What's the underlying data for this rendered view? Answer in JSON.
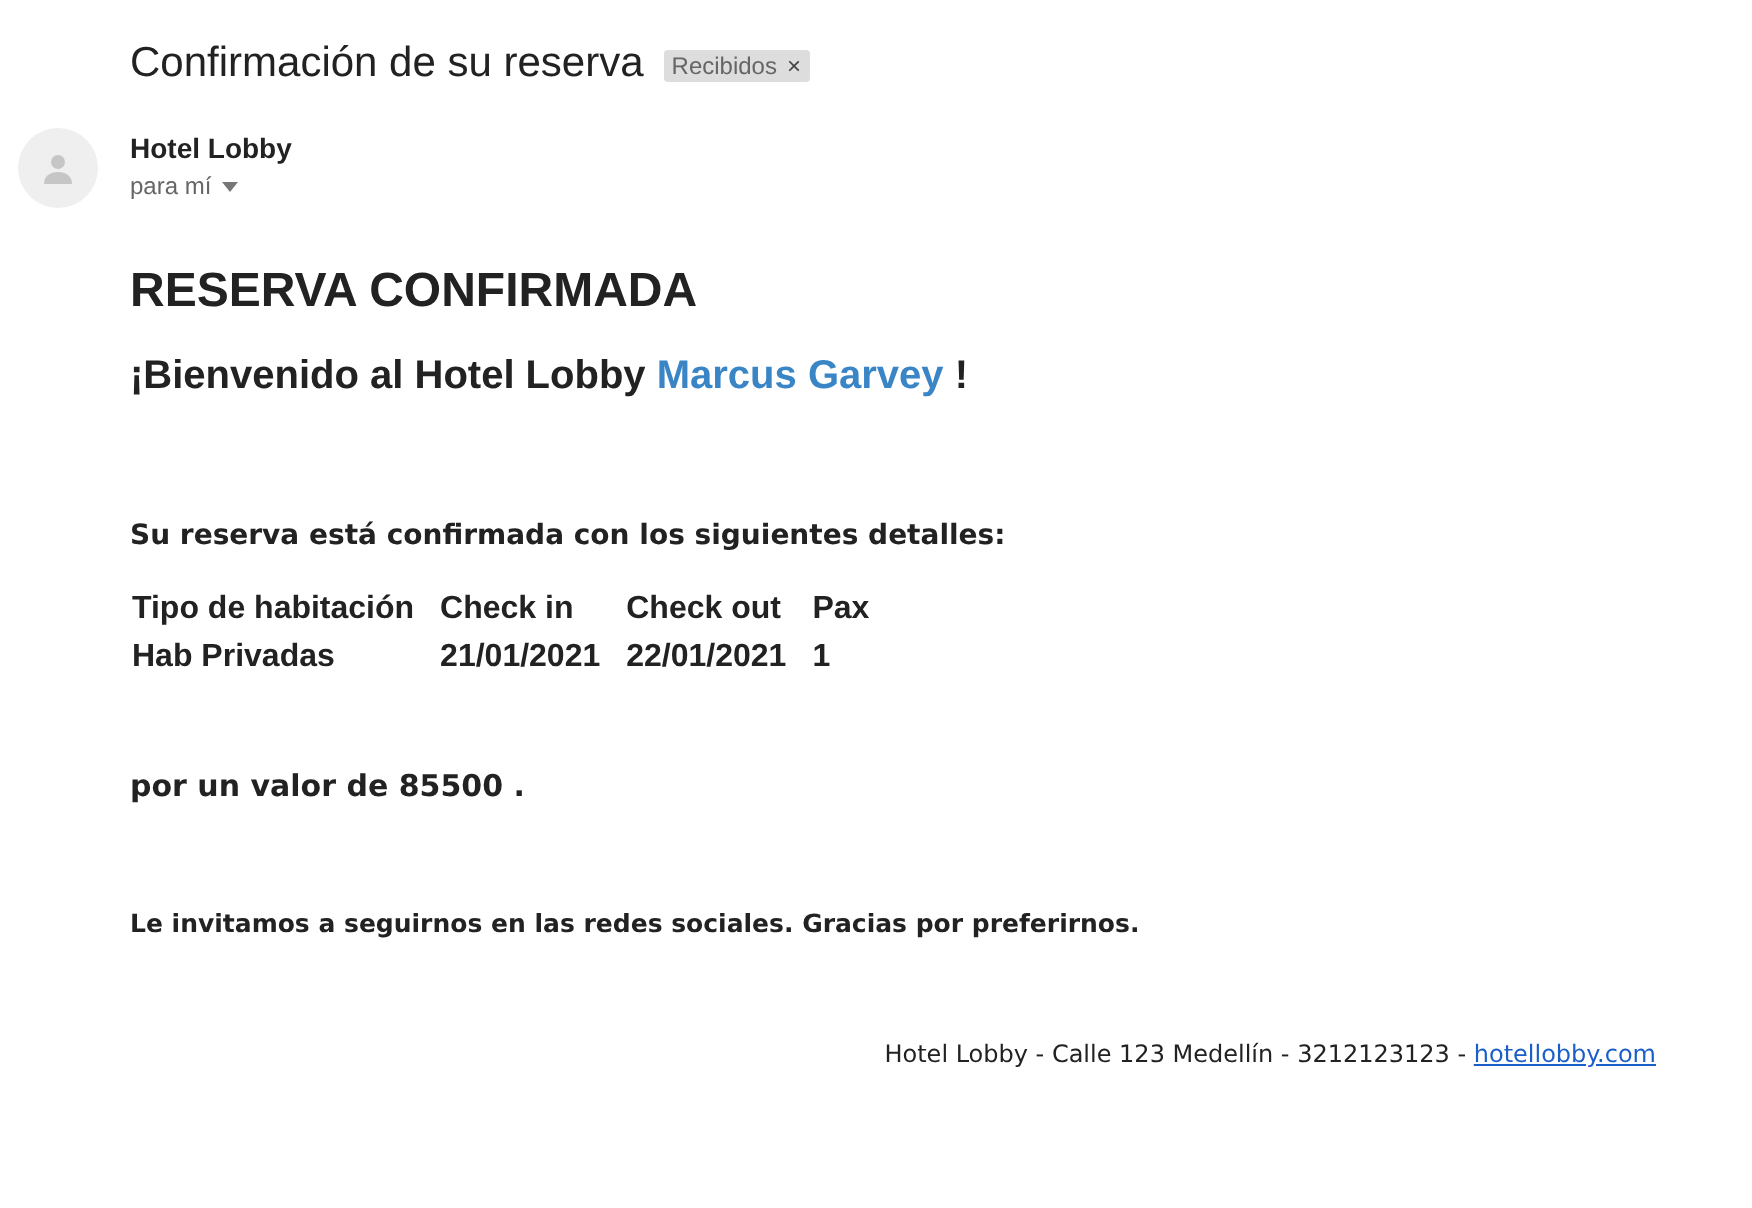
{
  "subject": "Confirmación de su reserva",
  "label_chip": {
    "text": "Recibidos",
    "close": "×"
  },
  "sender": {
    "name": "Hotel Lobby",
    "recipient": "para mí"
  },
  "body": {
    "heading": "RESERVA CONFIRMADA",
    "greeting": {
      "before": "¡Bienvenido al Hotel Lobby ",
      "guest": "Marcus Garvey",
      "after": " !"
    },
    "intro": "Su reserva está confirmada con los siguientes detalles:",
    "table": {
      "columns": [
        "Tipo de habitación",
        "Check in",
        "Check out",
        "Pax"
      ],
      "rows": [
        [
          "Hab Privadas",
          "21/01/2021",
          "22/01/2021",
          "1"
        ]
      ]
    },
    "price": "por un valor de 85500 .",
    "closing": "Le invitamos a seguirnos en las redes sociales. Gracias por preferirnos."
  },
  "footer": {
    "text": "Hotel Lobby - Calle 123 Medellín - 3212123123 - ",
    "link": "hotellobby.com"
  }
}
